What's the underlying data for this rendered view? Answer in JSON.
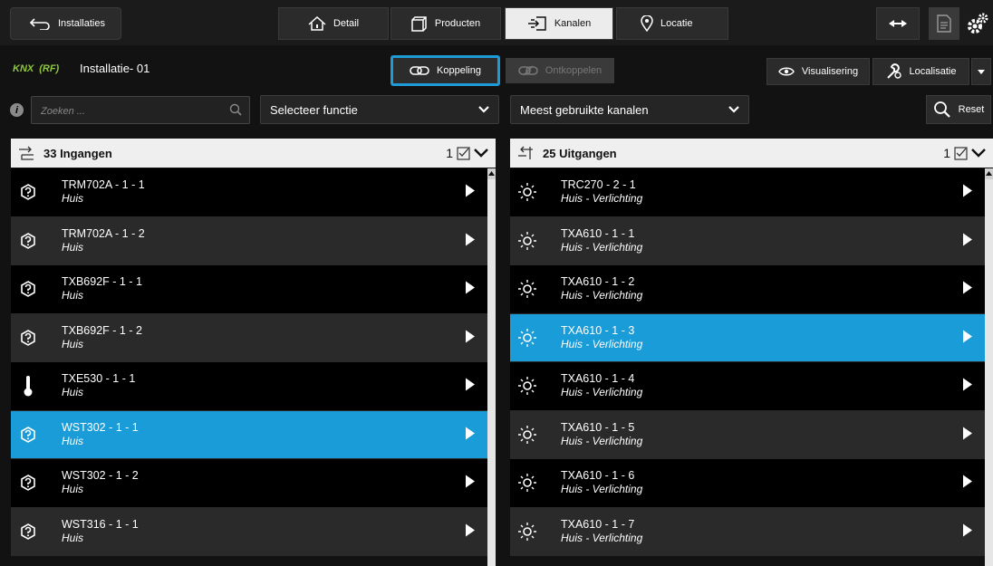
{
  "topbar": {
    "back_label": "Installaties",
    "tabs": [
      {
        "label": "Detail",
        "icon": "house-icon"
      },
      {
        "label": "Producten",
        "icon": "box-icon"
      },
      {
        "label": "Kanalen",
        "icon": "channels-icon",
        "active": true
      },
      {
        "label": "Locatie",
        "icon": "location-pin-icon"
      }
    ]
  },
  "toolbar": {
    "brand1": "KNX",
    "brand2": "(RF)",
    "installation_name": "Installatie- 01",
    "koppeling_label": "Koppeling",
    "ontkoppelen_label": "Ontkoppelen",
    "visualisering_label": "Visualisering",
    "localisatie_label": "Localisatie"
  },
  "filters": {
    "info_icon": "i",
    "search_placeholder": "Zoeken ...",
    "functie_value": "Selecteer functie",
    "kanalen_value": "Meest gebruikte kanalen",
    "reset_label": "Reset"
  },
  "inputs_panel": {
    "header": "33 Ingangen",
    "select_count": "1",
    "rows": [
      {
        "title": "TRM702A - 1 - 1",
        "sub": "Huis",
        "icon": "question-icon"
      },
      {
        "title": "TRM702A - 1 - 2",
        "sub": "Huis",
        "icon": "question-icon"
      },
      {
        "title": "TXB692F - 1 - 1",
        "sub": "Huis",
        "icon": "question-icon"
      },
      {
        "title": "TXB692F - 1 - 2",
        "sub": "Huis",
        "icon": "question-icon"
      },
      {
        "title": "TXE530 - 1 - 1",
        "sub": "Huis",
        "icon": "thermometer-icon"
      },
      {
        "title": "WST302 - 1 - 1",
        "sub": "Huis",
        "icon": "question-icon",
        "selected": true
      },
      {
        "title": "WST302 - 1 - 2",
        "sub": "Huis",
        "icon": "question-icon"
      },
      {
        "title": "WST316 - 1 - 1",
        "sub": "Huis",
        "icon": "question-icon"
      }
    ]
  },
  "outputs_panel": {
    "header": "25 Uitgangen",
    "select_count": "1",
    "rows": [
      {
        "title": "TRC270 - 2 - 1",
        "sub": "Huis - Verlichting",
        "icon": "light-icon"
      },
      {
        "title": "TXA610 - 1 - 1",
        "sub": "Huis - Verlichting",
        "icon": "light-icon"
      },
      {
        "title": "TXA610 - 1 - 2",
        "sub": "Huis - Verlichting",
        "icon": "light-icon"
      },
      {
        "title": "TXA610 - 1 - 3",
        "sub": "Huis - Verlichting",
        "icon": "light-icon",
        "selected": true
      },
      {
        "title": "TXA610 - 1 - 4",
        "sub": "Huis - Verlichting",
        "icon": "light-icon"
      },
      {
        "title": "TXA610 - 1 - 5",
        "sub": "Huis - Verlichting",
        "icon": "light-icon"
      },
      {
        "title": "TXA610 - 1 - 6",
        "sub": "Huis - Verlichting",
        "icon": "light-icon"
      },
      {
        "title": "TXA610 - 1 - 7",
        "sub": "Huis - Verlichting",
        "icon": "light-icon"
      }
    ]
  },
  "colors": {
    "accent": "#1a9cd8",
    "knx_green": "#8ec63f"
  }
}
